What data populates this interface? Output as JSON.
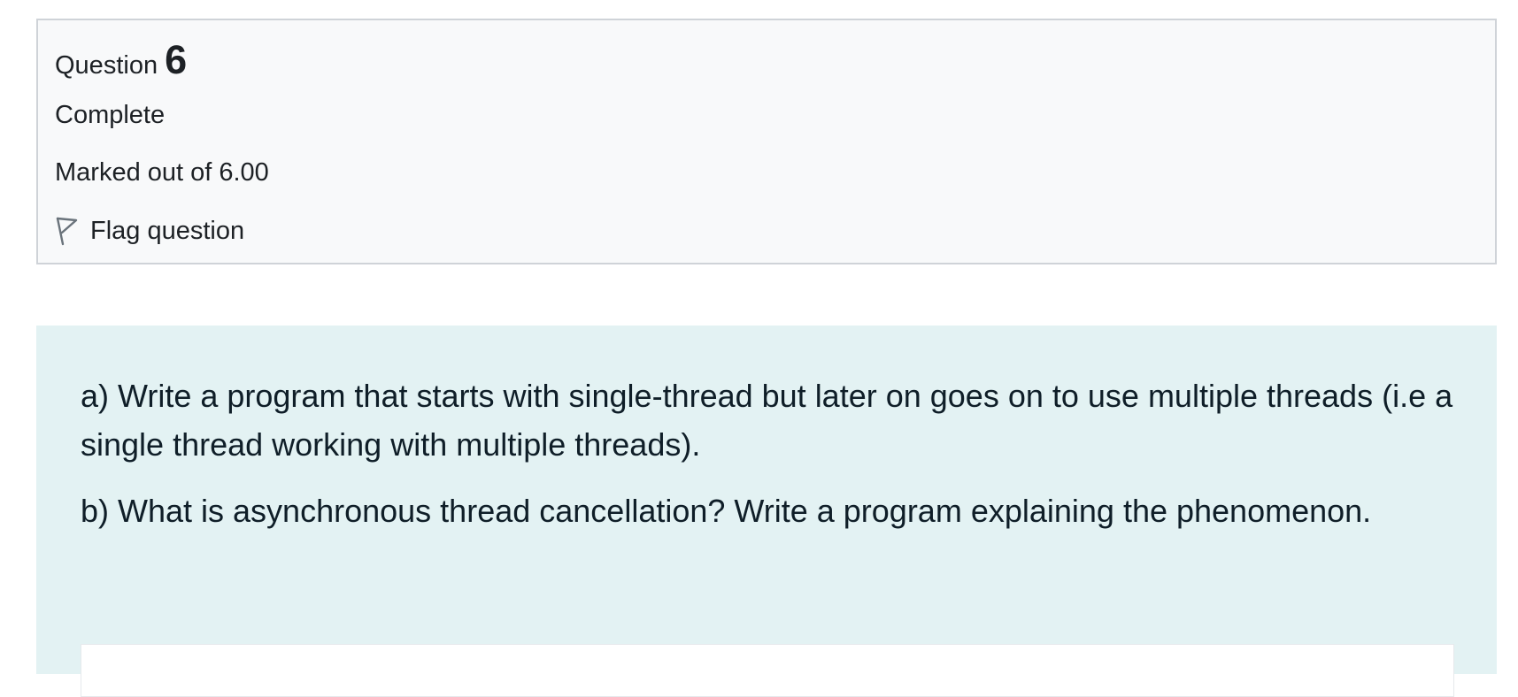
{
  "question_info": {
    "label": "Question",
    "number": "6",
    "state": "Complete",
    "grade": "Marked out of 6.00",
    "flag_label": "Flag question",
    "flag_icon": "flag-outline-icon"
  },
  "question_text": {
    "part_a": "a) Write a program that starts with single-thread but later on goes on to use multiple threads  (i.e a single thread working with multiple threads).",
    "part_b": "b) What is asynchronous thread cancellation? Write a program explaining the phenomenon."
  },
  "answer": {
    "value": ""
  },
  "colors": {
    "info_background": "#f8f9fa",
    "info_border": "#cfd3d8",
    "formulation_background": "#e3f2f3",
    "text": "#1d2125"
  }
}
